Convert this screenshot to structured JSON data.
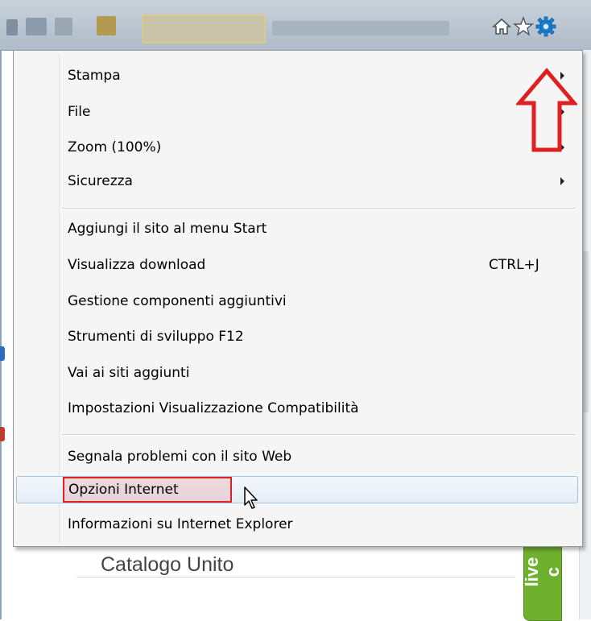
{
  "toolbar": {
    "icons": [
      "home-icon",
      "star-icon",
      "gear-icon"
    ]
  },
  "menu": {
    "items": [
      {
        "label": "Stampa",
        "submenu": true
      },
      {
        "label": "File",
        "submenu": true
      },
      {
        "label": "Zoom (100%)",
        "submenu": true
      },
      {
        "label": "Sicurezza",
        "submenu": true
      },
      {
        "label": "Aggiungi il sito al menu Start"
      },
      {
        "label": "Visualizza download",
        "shortcut": "CTRL+J"
      },
      {
        "label": "Gestione componenti aggiuntivi"
      },
      {
        "label": "Strumenti di sviluppo F12"
      },
      {
        "label": "Vai ai siti aggiunti"
      },
      {
        "label": "Impostazioni Visualizzazione Compatibilità"
      },
      {
        "label": "Segnala problemi con il sito Web"
      },
      {
        "label": "Opzioni Internet",
        "hovered": true,
        "highlighted": true
      },
      {
        "label": "Informazioni su Internet Explorer"
      }
    ]
  },
  "background_page": {
    "catalog_title": "Catalogo Unito",
    "live_tab_label": "live c"
  },
  "colors": {
    "annotation_red": "#e02020",
    "gear_blue": "#1d7fd1",
    "live_green": "#6fb02e"
  }
}
